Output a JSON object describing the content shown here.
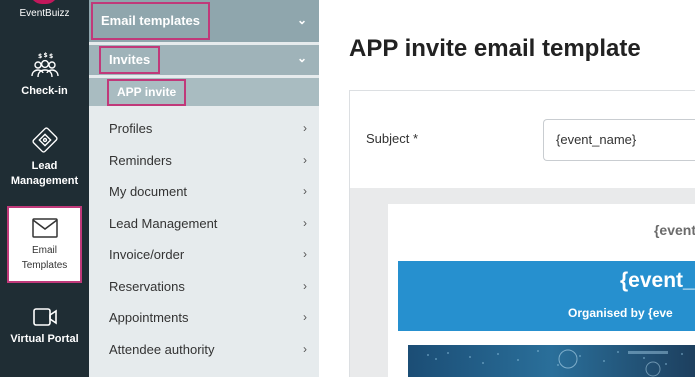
{
  "rail": {
    "brand": "EventBuizz",
    "items": [
      {
        "label": "Check-in"
      },
      {
        "label": "Lead Management"
      },
      {
        "label": "Email Templates"
      },
      {
        "label": "Virtual Portal"
      }
    ]
  },
  "subnav": {
    "group": "Email templates",
    "subgroup": "Invites",
    "active_leaf": "APP invite",
    "items": [
      "Profiles",
      "Reminders",
      "My document",
      "Lead Management",
      "Invoice/order",
      "Reservations",
      "Appointments",
      "Attendee authority"
    ]
  },
  "main": {
    "title": "APP invite email template",
    "subject_label": "Subject *",
    "subject_value": "{event_name}",
    "preview": {
      "top_text": "{event",
      "banner_title": "{event_",
      "banner_sub": "Organised by  {eve"
    }
  },
  "colors": {
    "rail_bg": "#1f2d34",
    "highlight": "#c0397a",
    "banner": "#2690cf",
    "subnav_bg": "#e6ebed"
  }
}
